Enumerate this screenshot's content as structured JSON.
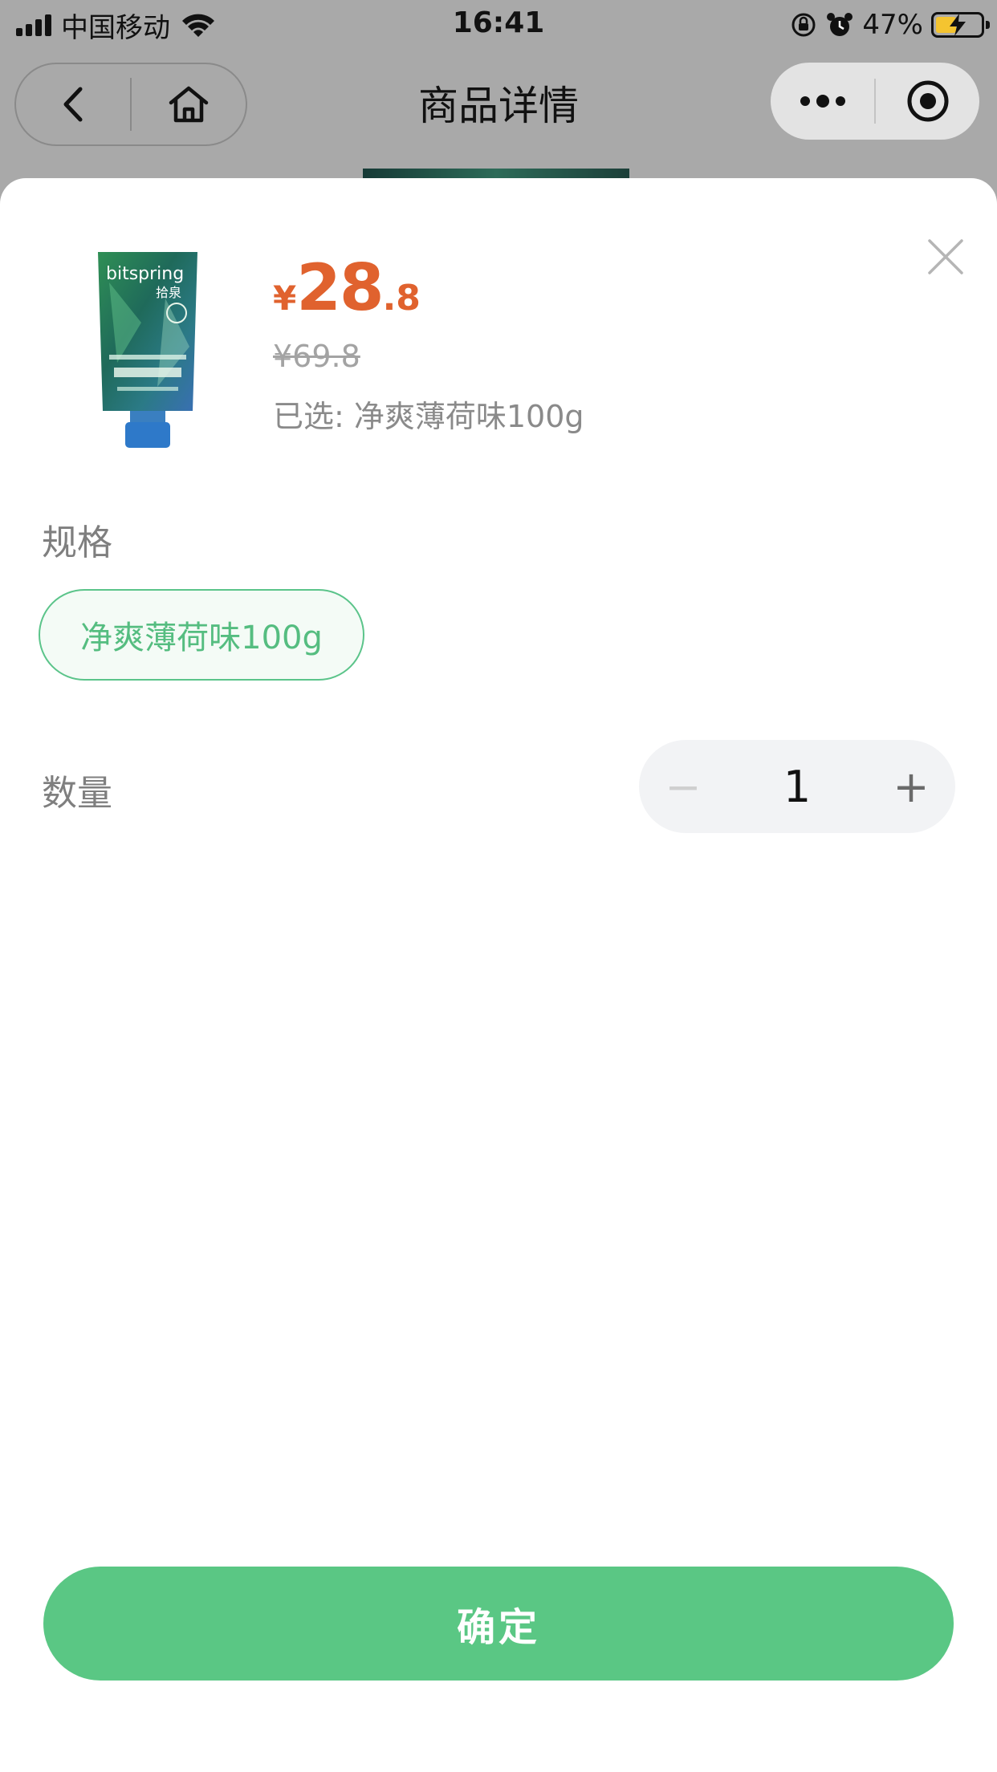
{
  "status_bar": {
    "carrier": "中国移动",
    "time": "16:41",
    "battery_percent": "47%",
    "battery_level": 0.47
  },
  "nav": {
    "title": "商品详情",
    "icons": [
      "back-icon",
      "home-icon",
      "more-icon",
      "record-icon"
    ]
  },
  "product": {
    "price_currency": "¥",
    "price_integer": "28",
    "price_decimal": ".8",
    "original_price": "¥69.8",
    "selected_text": "已选: 净爽薄荷味100g",
    "image": "toothpaste-tube-green",
    "brand_text": "bitspring",
    "brand_cn": "拾泉"
  },
  "spec": {
    "label": "规格",
    "options": [
      {
        "label": "净爽薄荷味100g",
        "selected": true
      }
    ]
  },
  "quantity": {
    "label": "数量",
    "minus": "−",
    "value": "1",
    "plus": "+"
  },
  "confirm_label": "确定",
  "colors": {
    "accent_green": "#5ac784",
    "price_orange": "#e0622e",
    "overlay": "#a9a9a9"
  }
}
